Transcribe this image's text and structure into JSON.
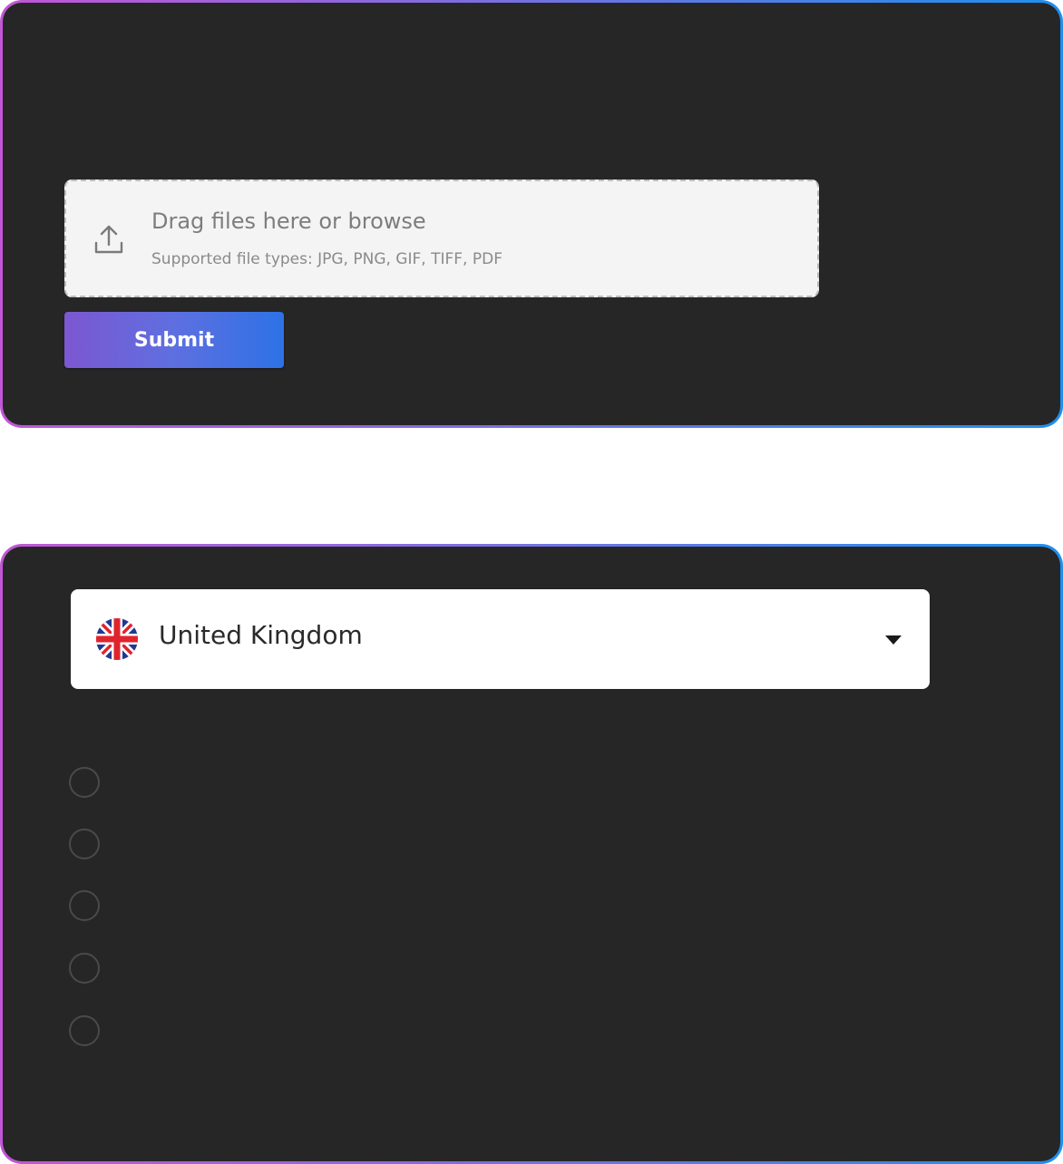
{
  "upload": {
    "title": "Drag files here or browse",
    "subtitle": "Supported file types: JPG, PNG, GIF, TIFF, PDF",
    "icon": "upload-icon",
    "submit_label": "Submit"
  },
  "country_select": {
    "selected": "United Kingdom",
    "flag_icon": "uk-flag-icon",
    "dropdown_icon": "chevron-down-icon"
  },
  "question": {
    "label": "",
    "options": [
      "",
      "",
      "",
      "",
      ""
    ]
  },
  "colors": {
    "card_background": "#262626",
    "border_gradient_start": "#c356d6",
    "border_gradient_end": "#1e90ee",
    "submit_gradient_start": "#7d57d1",
    "submit_gradient_end": "#2d72e6"
  }
}
